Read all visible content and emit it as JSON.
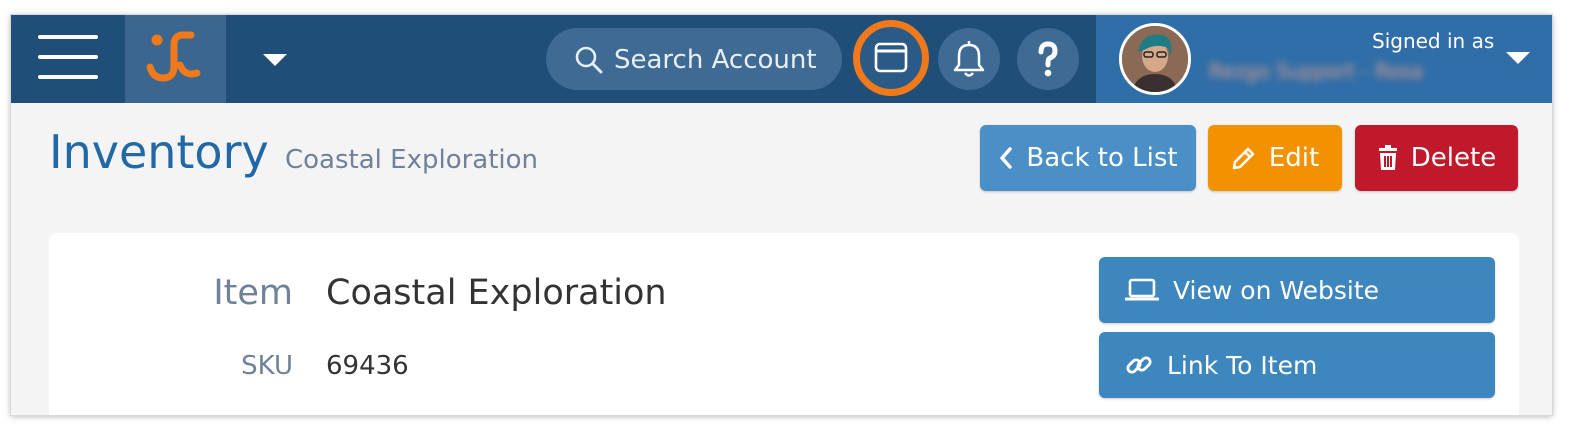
{
  "header": {
    "search_placeholder": "Search Account",
    "signed_in_label": "Signed in as",
    "user_name": "Rezgo Support - Rosa"
  },
  "page": {
    "title": "Inventory",
    "subtitle": "Coastal Exploration"
  },
  "actions": {
    "back_label": "Back to List",
    "edit_label": "Edit",
    "delete_label": "Delete"
  },
  "item": {
    "item_label": "Item",
    "item_value": "Coastal Exploration",
    "sku_label": "SKU",
    "sku_value": "69436"
  },
  "side_actions": {
    "view_label": "View on Website",
    "link_label": "Link To Item"
  },
  "icons": [
    "hamburger-menu-icon",
    "logo-icon",
    "chevron-down-icon",
    "search-icon",
    "window-icon",
    "bell-icon",
    "help-icon",
    "chevron-left-icon",
    "pencil-icon",
    "trash-icon",
    "laptop-icon",
    "link-icon"
  ],
  "colors": {
    "topbar": "#1f4e79",
    "accent_orange": "#f07a1b",
    "title_blue": "#2168a7",
    "back_button": "#4a90c6",
    "edit_button": "#f39200",
    "delete_button": "#c0192b",
    "side_button": "#3d86be"
  }
}
